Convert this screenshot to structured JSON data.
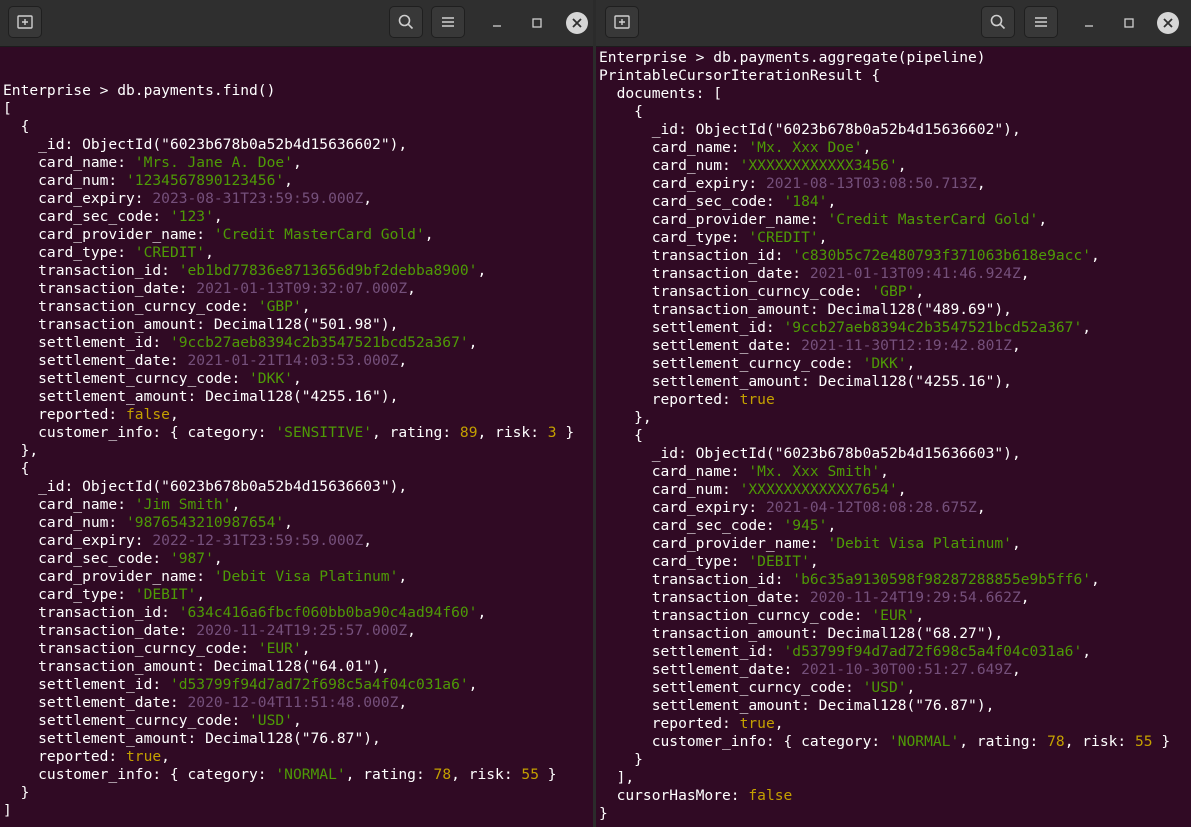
{
  "colors": {
    "terminal_bg": "#300a24",
    "titlebar_bg": "#2f2f2f",
    "string": "#4e9a06",
    "date": "#75507b",
    "number_bool": "#c4a000",
    "text": "#ffffff"
  },
  "titlebar_icons": [
    "new-tab-icon",
    "search-icon",
    "hamburger-menu-icon",
    "minimize-icon",
    "maximize-icon",
    "close-icon"
  ],
  "left": {
    "prompt": "Enterprise > db.payments.find()",
    "open_bracket": "[",
    "close_bracket": "]",
    "docs": [
      {
        "id": "6023b678b0a52b4d15636602",
        "card_name": "'Mrs. Jane A. Doe'",
        "card_num": "'1234567890123456'",
        "card_expiry": "2023-08-31T23:59:59.000Z",
        "card_sec_code": "'123'",
        "card_provider_name": "'Credit MasterCard Gold'",
        "card_type": "'CREDIT'",
        "transaction_id": "'eb1bd77836e8713656d9bf2debba8900'",
        "transaction_date": "2021-01-13T09:32:07.000Z",
        "transaction_curncy_code": "'GBP'",
        "transaction_amount": "501.98",
        "settlement_id": "'9ccb27aeb8394c2b3547521bcd52a367'",
        "settlement_date": "2021-01-21T14:03:53.000Z",
        "settlement_curncy_code": "'DKK'",
        "settlement_amount": "4255.16",
        "reported": "false",
        "category": "'SENSITIVE'",
        "rating": "89",
        "risk": "3"
      },
      {
        "id": "6023b678b0a52b4d15636603",
        "card_name": "'Jim Smith'",
        "card_num": "'9876543210987654'",
        "card_expiry": "2022-12-31T23:59:59.000Z",
        "card_sec_code": "'987'",
        "card_provider_name": "'Debit Visa Platinum'",
        "card_type": "'DEBIT'",
        "transaction_id": "'634c416a6fbcf060bb0ba90c4ad94f60'",
        "transaction_date": "2020-11-24T19:25:57.000Z",
        "transaction_curncy_code": "'EUR'",
        "transaction_amount": "64.01",
        "settlement_id": "'d53799f94d7ad72f698c5a4f04c031a6'",
        "settlement_date": "2020-12-04T11:51:48.000Z",
        "settlement_curncy_code": "'USD'",
        "settlement_amount": "76.87",
        "reported": "true",
        "category": "'NORMAL'",
        "rating": "78",
        "risk": "55"
      }
    ]
  },
  "right": {
    "prompt": "Enterprise > db.payments.aggregate(pipeline)",
    "result_header": "PrintableCursorIterationResult {",
    "documents_label": "  documents: [",
    "documents_close": "  ],",
    "cursor_label": "  cursorHasMore: ",
    "cursor_value": "false",
    "close_brace": "}",
    "docs": [
      {
        "id": "6023b678b0a52b4d15636602",
        "card_name": "'Mx. Xxx Doe'",
        "card_num": "'XXXXXXXXXXXX3456'",
        "card_expiry": "2021-08-13T03:08:50.713Z",
        "card_sec_code": "'184'",
        "card_provider_name": "'Credit MasterCard Gold'",
        "card_type": "'CREDIT'",
        "transaction_id": "'c830b5c72e480793f371063b618e9acc'",
        "transaction_date": "2021-01-13T09:41:46.924Z",
        "transaction_curncy_code": "'GBP'",
        "transaction_amount": "489.69",
        "settlement_id": "'9ccb27aeb8394c2b3547521bcd52a367'",
        "settlement_date": "2021-11-30T12:19:42.801Z",
        "settlement_curncy_code": "'DKK'",
        "settlement_amount": "4255.16",
        "reported": "true"
      },
      {
        "id": "6023b678b0a52b4d15636603",
        "card_name": "'Mx. Xxx Smith'",
        "card_num": "'XXXXXXXXXXXX7654'",
        "card_expiry": "2021-04-12T08:08:28.675Z",
        "card_sec_code": "'945'",
        "card_provider_name": "'Debit Visa Platinum'",
        "card_type": "'DEBIT'",
        "transaction_id": "'b6c35a9130598f98287288855e9b5ff6'",
        "transaction_date": "2020-11-24T19:29:54.662Z",
        "transaction_curncy_code": "'EUR'",
        "transaction_amount": "68.27",
        "settlement_id": "'d53799f94d7ad72f698c5a4f04c031a6'",
        "settlement_date": "2021-10-30T00:51:27.649Z",
        "settlement_curncy_code": "'USD'",
        "settlement_amount": "76.87",
        "reported": "true",
        "category": "'NORMAL'",
        "rating": "78",
        "risk": "55"
      }
    ]
  }
}
